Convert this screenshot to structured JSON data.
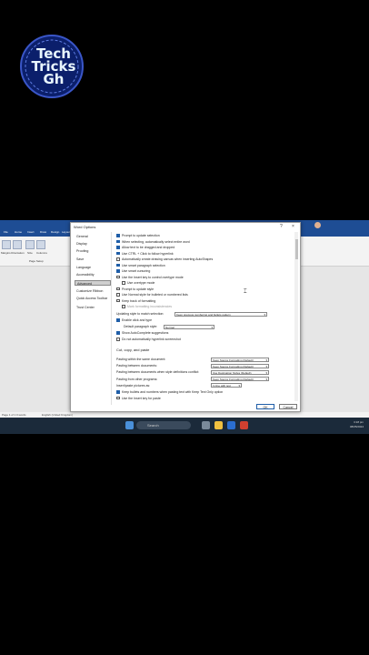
{
  "logo": {
    "lines": [
      "Tech",
      "Tricks",
      "Gh"
    ]
  },
  "word": {
    "tabs": [
      "File",
      "Home",
      "Insert",
      "Draw",
      "Design",
      "Layout"
    ],
    "ribbon_labels": [
      "Margins",
      "Orientation",
      "Size",
      "Columns"
    ],
    "group_label": "Page Setup",
    "status_left": "Page 1 of 1",
    "status_words": "0 words",
    "status_language": "English (United Kingdom)"
  },
  "dialog": {
    "title": "Word Options",
    "controls": {
      "help": "?",
      "close": "×"
    },
    "nav": [
      "General",
      "Display",
      "Proofing",
      "Save",
      "Language",
      "Accessibility",
      "Advanced",
      "Customize Ribbon",
      "Quick Access Toolbar",
      "Trust Center"
    ],
    "selected_nav": "Advanced",
    "options": [
      {
        "label": "Prompt to update selection",
        "checked": true
      },
      {
        "label": "When selecting, automatically select entire word",
        "checked": true
      },
      {
        "label": "Allow text to be dragged and dropped",
        "checked": true
      },
      {
        "label": "Use CTRL + Click to follow hyperlink",
        "checked": true
      },
      {
        "label": "Automatically create drawing canvas when inserting AutoShapes",
        "checked": false
      },
      {
        "label": "Use smart paragraph selection",
        "checked": true
      },
      {
        "label": "Use smart cursoring",
        "checked": true
      },
      {
        "label": "Use the Insert key to control overtype mode",
        "checked": false
      },
      {
        "label": "Use overtype mode",
        "checked": false,
        "indent": true
      },
      {
        "label": "Prompt to update style",
        "checked": false
      },
      {
        "label": "Use Normal style for bulleted or numbered lists",
        "checked": false
      },
      {
        "label": "Keep track of formatting",
        "checked": false
      },
      {
        "label": "Mark formatting inconsistencies",
        "checked": false,
        "indent": true,
        "disabled": true
      }
    ],
    "updating_style": {
      "label": "Updating style to match selection:",
      "value": "Keep previous numbering and bullets pattern"
    },
    "enable_click_type": {
      "label": "Enable click and type",
      "checked": true
    },
    "default_para": {
      "label": "Default paragraph style:",
      "value": "Normal"
    },
    "autocomplete": {
      "label": "Show AutoComplete suggestions",
      "checked": true
    },
    "hyperlink": {
      "label": "Do not automatically hyperlink screenshot",
      "checked": false
    },
    "section_title": "Cut, copy, and paste",
    "paste_rows": [
      {
        "label": "Pasting within the same document:",
        "value": "Keep Source Formatting (Default)"
      },
      {
        "label": "Pasting between documents:",
        "value": "Keep Source Formatting (Default)"
      },
      {
        "label": "Pasting between documents when style definitions conflict:",
        "value": "Use Destination Styles (Default)"
      },
      {
        "label": "Pasting from other programs:",
        "value": "Keep Source Formatting (Default)"
      },
      {
        "label": "Insert/paste pictures as:",
        "value": "In line with text"
      }
    ],
    "paste_checks": [
      {
        "label": "Keep bullets and numbers when pasting text with Keep Text Only option",
        "checked": true
      },
      {
        "label": "Use the Insert key for paste",
        "checked": false
      }
    ],
    "ok": "OK",
    "cancel": "Cancel"
  },
  "taskbar": {
    "search_placeholder": "Search",
    "time": "3:18 pm",
    "date": "08/05/2024"
  },
  "colors": {
    "word_blue": "#1e4d94",
    "check_blue": "#1f5ea8",
    "taskbar": "#1b2a3a"
  }
}
